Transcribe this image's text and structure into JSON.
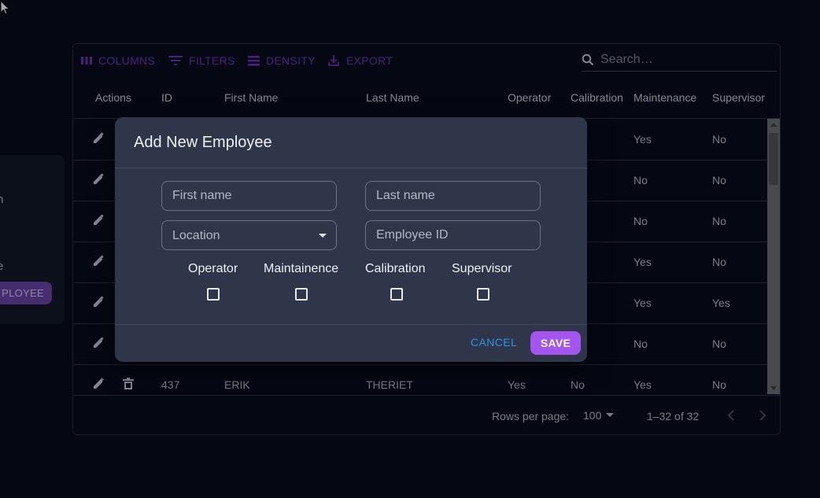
{
  "side_panel": {
    "text1": "n",
    "text2": "e",
    "button_label": "PLOYEE"
  },
  "toolbar": {
    "columns_label": "COLUMNS",
    "filters_label": "FILTERS",
    "density_label": "DENSITY",
    "export_label": "EXPORT",
    "search_placeholder": "Search…"
  },
  "grid": {
    "headers": [
      "Actions",
      "ID",
      "First Name",
      "Last Name",
      "Operator",
      "Calibration",
      "Maintenance",
      "Supervisor"
    ],
    "rows": [
      {
        "id": "",
        "first": "",
        "last": "",
        "operator": "",
        "calibration": "s",
        "maintenance": "Yes",
        "supervisor": "No"
      },
      {
        "id": "",
        "first": "",
        "last": "",
        "operator": "",
        "calibration": "",
        "maintenance": "No",
        "supervisor": "No"
      },
      {
        "id": "",
        "first": "",
        "last": "",
        "operator": "",
        "calibration": "",
        "maintenance": "No",
        "supervisor": "No"
      },
      {
        "id": "",
        "first": "",
        "last": "",
        "operator": "",
        "calibration": "",
        "maintenance": "Yes",
        "supervisor": "No"
      },
      {
        "id": "",
        "first": "",
        "last": "",
        "operator": "",
        "calibration": "s",
        "maintenance": "Yes",
        "supervisor": "Yes"
      },
      {
        "id": "",
        "first": "",
        "last": "",
        "operator": "",
        "calibration": "s",
        "maintenance": "No",
        "supervisor": "No"
      },
      {
        "id": "437",
        "first": "ERIK",
        "last": "THERIET",
        "operator": "Yes",
        "calibration": "No",
        "maintenance": "Yes",
        "supervisor": "No"
      }
    ]
  },
  "footer": {
    "rows_per_page_label": "Rows per page:",
    "rows_per_page_value": "100",
    "range": "1–32 of 32"
  },
  "modal": {
    "title": "Add New Employee",
    "first_name_placeholder": "First name",
    "last_name_placeholder": "Last name",
    "location_placeholder": "Location",
    "employee_id_placeholder": "Employee ID",
    "checkboxes": [
      "Operator",
      "Maintainence",
      "Calibration",
      "Supervisor"
    ],
    "cancel_label": "CANCEL",
    "save_label": "SAVE"
  },
  "colors": {
    "accent": "#a455f0",
    "toolbar_text": "#6c2fb3",
    "cancel_text": "#2f93e6",
    "modal_bg": "#2f3649",
    "page_bg": "#060913"
  }
}
